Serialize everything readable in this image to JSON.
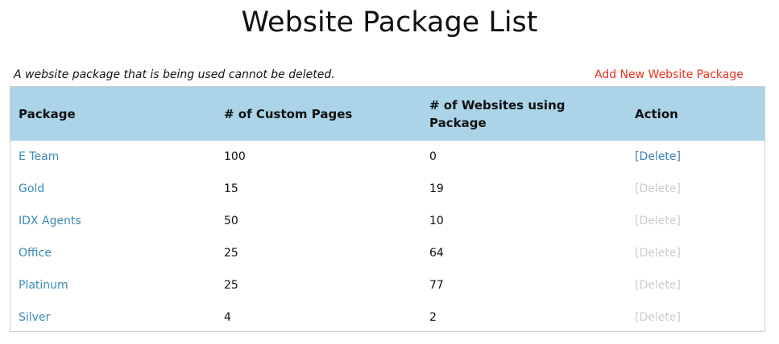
{
  "page": {
    "title": "Website Package List",
    "note": "A website package that is being used cannot be deleted.",
    "add_link": "Add New Website Package"
  },
  "colors": {
    "header_bg": "#acd4e8",
    "link": "#3a8bb6",
    "add_link": "#e8321e",
    "disabled": "#cccccc"
  },
  "table": {
    "headers": [
      "Package",
      "# of Custom Pages",
      "# of Websites using Package",
      "Action"
    ],
    "rows": [
      {
        "package": "E Team",
        "custom_pages": "100",
        "websites": "0",
        "action": "[Delete]",
        "action_enabled": true
      },
      {
        "package": "Gold",
        "custom_pages": "15",
        "websites": "19",
        "action": "[Delete]",
        "action_enabled": false
      },
      {
        "package": "IDX Agents",
        "custom_pages": "50",
        "websites": "10",
        "action": "[Delete]",
        "action_enabled": false
      },
      {
        "package": "Office",
        "custom_pages": "25",
        "websites": "64",
        "action": "[Delete]",
        "action_enabled": false
      },
      {
        "package": "Platinum",
        "custom_pages": "25",
        "websites": "77",
        "action": "[Delete]",
        "action_enabled": false
      },
      {
        "package": "Silver",
        "custom_pages": "4",
        "websites": "2",
        "action": "[Delete]",
        "action_enabled": false
      }
    ]
  }
}
